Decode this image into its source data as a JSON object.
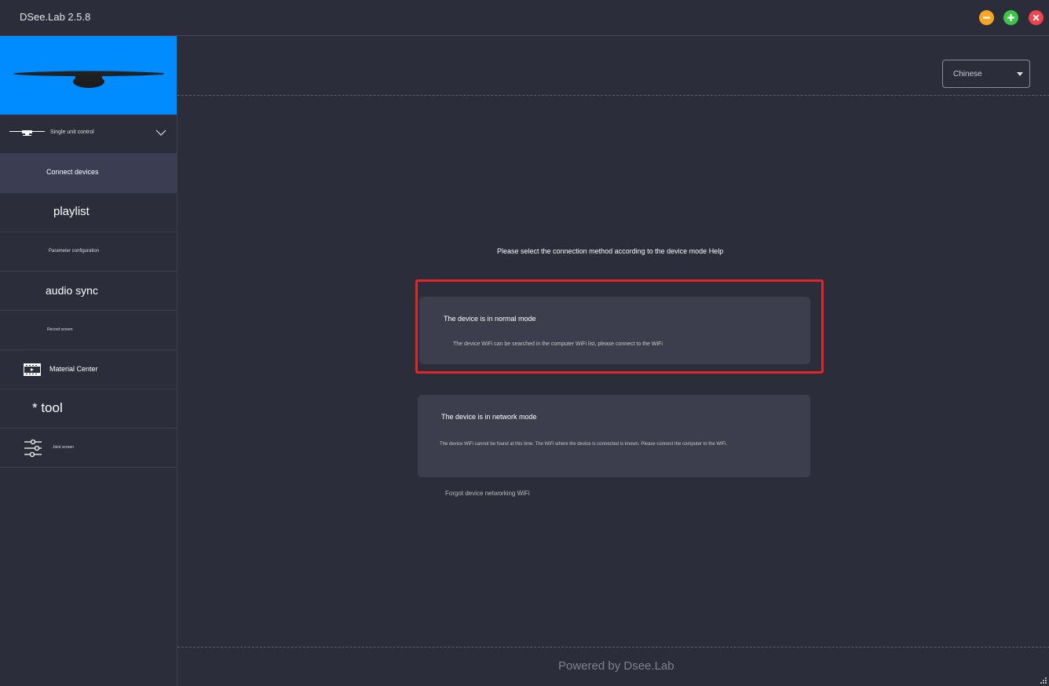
{
  "window": {
    "title": "DSee.Lab 2.5.8",
    "controls": [
      {
        "name": "minimize",
        "color": "#f5a623"
      },
      {
        "name": "maximize",
        "color": "#3ec54a"
      },
      {
        "name": "close",
        "color": "#f0434b"
      }
    ]
  },
  "sidebar": {
    "device_image": {
      "background": "#008cff"
    },
    "group": {
      "label": "Single unit control",
      "icon": "monitor-icon",
      "expanded": true
    },
    "items": [
      {
        "label": "Connect devices",
        "active": true
      },
      {
        "label": "playlist"
      },
      {
        "label": "Parameter configuration"
      },
      {
        "label": "audio sync"
      },
      {
        "label": "Record screen"
      },
      {
        "label": "Material Center",
        "icon": "film-icon"
      },
      {
        "label": "* tool"
      },
      {
        "label": "Joint screen",
        "icon": "sliders-icon"
      }
    ]
  },
  "header": {
    "language": {
      "value": "Chinese"
    }
  },
  "main": {
    "instruction": "Please select the connection method according to the device mode",
    "help_label": "Help",
    "cards": [
      {
        "title": "The device is in normal mode",
        "description": "The device WiFi can be searched in the computer WiFi list, please connect to the WiFi",
        "highlighted": true
      },
      {
        "title": "The device is in network mode",
        "description": "The device WiFi cannot be found at this time. The WiFi where the device is connected is known. Please connect the computer to the WiFi."
      }
    ],
    "forgot_link": "Forgot device networking WiFi"
  },
  "footer": {
    "text": "Powered by Dsee.Lab"
  },
  "colors": {
    "background": "#2b2d3b",
    "card": "#3c3e4d",
    "highlight": "#e3262a",
    "active_item": "#3b3e52"
  }
}
